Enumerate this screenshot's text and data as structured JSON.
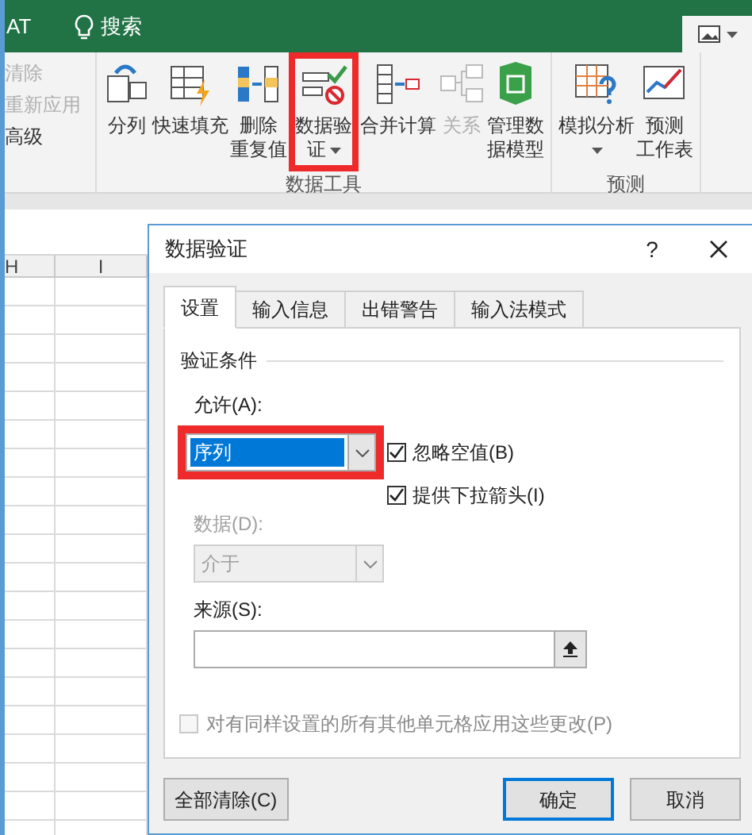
{
  "title_bar": {
    "tab_fragment": "AT",
    "search": "搜索"
  },
  "ribbon": {
    "sort_filter_items": [
      {
        "label": "清除",
        "disabled": true
      },
      {
        "label": "重新应用",
        "disabled": true
      },
      {
        "label": "高级",
        "disabled": false
      }
    ],
    "groups": [
      {
        "label": "数据工具",
        "buttons": [
          {
            "kind": "split",
            "lines": [
              "分列"
            ],
            "disabled": false,
            "dropdown": false,
            "highlighted": false
          },
          {
            "kind": "flash",
            "lines": [
              "快速填充"
            ],
            "disabled": false,
            "dropdown": false,
            "highlighted": false
          },
          {
            "kind": "dedupe",
            "lines": [
              "删除",
              "重复值"
            ],
            "disabled": false,
            "dropdown": false,
            "highlighted": false
          },
          {
            "kind": "validate",
            "lines": [
              "数据验",
              "证"
            ],
            "disabled": false,
            "dropdown": true,
            "highlighted": true
          },
          {
            "kind": "consolidate",
            "lines": [
              "合并计算"
            ],
            "disabled": false,
            "dropdown": false,
            "highlighted": false
          },
          {
            "kind": "relations",
            "lines": [
              "关系"
            ],
            "disabled": true,
            "dropdown": false,
            "highlighted": false
          },
          {
            "kind": "model",
            "lines": [
              "管理数",
              "据模型"
            ],
            "disabled": false,
            "dropdown": false,
            "highlighted": false
          }
        ]
      },
      {
        "label": "预测",
        "buttons": [
          {
            "kind": "whatif",
            "lines": [
              "模拟分析"
            ],
            "disabled": false,
            "dropdown": true,
            "highlighted": false
          },
          {
            "kind": "forecast",
            "lines": [
              "预测",
              "工作表"
            ],
            "disabled": false,
            "dropdown": false,
            "highlighted": false
          }
        ]
      }
    ]
  },
  "sheet": {
    "columns": [
      "H",
      "I"
    ]
  },
  "dialog": {
    "title": "数据验证",
    "help": "?",
    "tabs": [
      {
        "label": "设置",
        "selected": true
      },
      {
        "label": "输入信息",
        "selected": false
      },
      {
        "label": "出错警告",
        "selected": false
      },
      {
        "label": "输入法模式",
        "selected": false
      }
    ],
    "section": "验证条件",
    "allow": {
      "label": "允许(A):",
      "value": "序列",
      "highlighted": true
    },
    "options": [
      {
        "label": "忽略空值(B)",
        "checked": true
      },
      {
        "label": "提供下拉箭头(I)",
        "checked": true
      }
    ],
    "data": {
      "label": "数据(D):",
      "value": "介于",
      "disabled": true
    },
    "source": {
      "label": "来源(S):"
    },
    "apply_all": {
      "label": "对有同样设置的所有其他单元格应用这些更改(P)",
      "checked": false,
      "disabled": true
    },
    "buttons": [
      {
        "label": "全部清除(C)",
        "default": false
      },
      {
        "label": "确定",
        "default": true
      },
      {
        "label": "取消",
        "default": false
      }
    ]
  }
}
